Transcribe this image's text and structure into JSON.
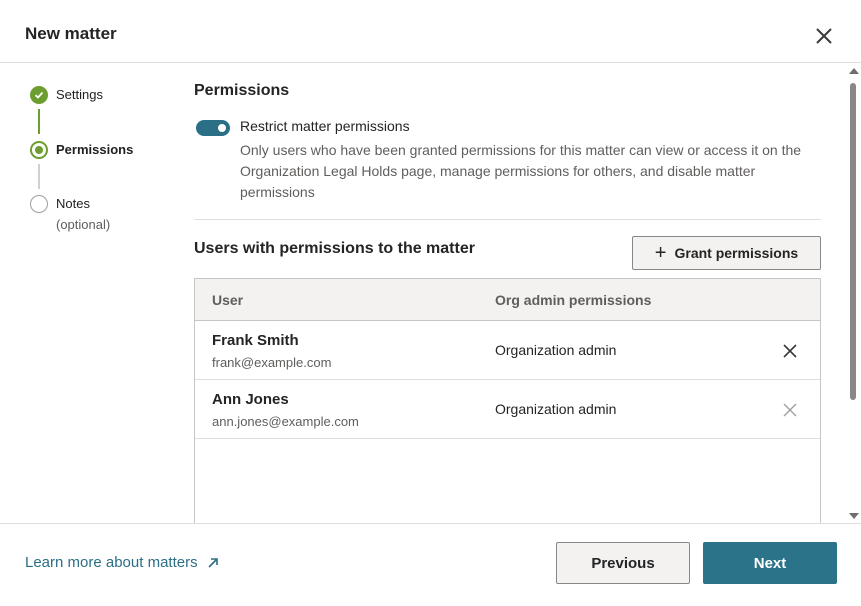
{
  "dialog": {
    "title": "New matter",
    "close_icon": "close-icon"
  },
  "steps": [
    {
      "label": "Settings",
      "sublabel": "",
      "state": "completed"
    },
    {
      "label": "Permissions",
      "sublabel": "",
      "state": "current"
    },
    {
      "label": "Notes",
      "sublabel": "(optional)",
      "state": "upcoming"
    }
  ],
  "permissions": {
    "section_title": "Permissions",
    "toggle": {
      "label": "Restrict matter permissions",
      "checked": true,
      "description": "Only users who have been granted permissions for this matter can view or access it on the Organization Legal Holds page, manage permissions for others, and disable matter permissions"
    },
    "users_title": "Users with permissions to the matter",
    "grant_button": "Grant permissions",
    "table": {
      "columns": [
        "User",
        "Org admin permissions"
      ],
      "rows": [
        {
          "name": "Frank Smith",
          "email": "frank@example.com",
          "org_permission": "Organization admin",
          "remove_enabled": true
        },
        {
          "name": "Ann Jones",
          "email": "ann.jones@example.com",
          "org_permission": "Organization admin",
          "remove_enabled": false
        }
      ]
    }
  },
  "footer": {
    "learn_more": "Learn more about matters",
    "previous": "Previous",
    "next": "Next"
  },
  "colors": {
    "accent": "#2b7389",
    "step_green": "#6b9e2f",
    "link": "#2b6f86"
  }
}
